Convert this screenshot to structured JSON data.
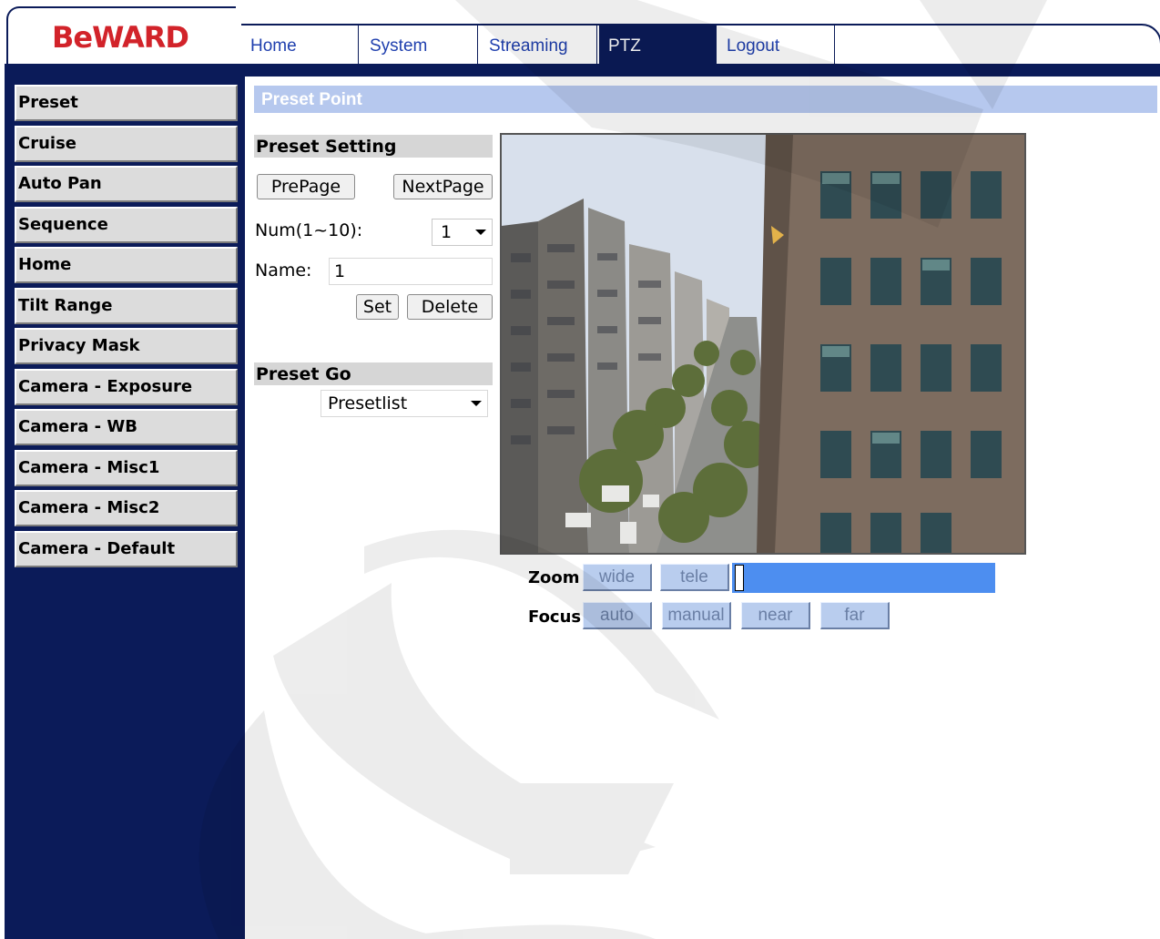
{
  "logo": {
    "text": "BeWARD"
  },
  "tabs": [
    {
      "label": "Home"
    },
    {
      "label": "System"
    },
    {
      "label": "Streaming"
    },
    {
      "label": "PTZ"
    },
    {
      "label": "Logout"
    }
  ],
  "sidebar": {
    "items": [
      {
        "label": "Preset"
      },
      {
        "label": "Cruise"
      },
      {
        "label": "Auto Pan"
      },
      {
        "label": "Sequence"
      },
      {
        "label": "Home"
      },
      {
        "label": "Tilt Range"
      },
      {
        "label": "Privacy Mask"
      },
      {
        "label": "Camera - Exposure"
      },
      {
        "label": "Camera - WB"
      },
      {
        "label": "Camera - Misc1"
      },
      {
        "label": "Camera - Misc2"
      },
      {
        "label": "Camera - Default"
      }
    ]
  },
  "page": {
    "title": "Preset Point"
  },
  "preset_setting": {
    "header": "Preset Setting",
    "prev_label": "PrePage",
    "next_label": "NextPage",
    "num_label": "Num(1~10):",
    "num_value": "1",
    "name_label": "Name:",
    "name_value": "1",
    "set_label": "Set",
    "delete_label": "Delete"
  },
  "preset_go": {
    "header": "Preset Go",
    "select_value": "Presetlist"
  },
  "ptz": {
    "zoom_label": "Zoom",
    "wide_label": "wide",
    "tele_label": "tele",
    "focus_label": "Focus",
    "auto_label": "auto",
    "manual_label": "manual",
    "near_label": "near",
    "far_label": "far"
  },
  "colors": {
    "navy": "#0b1b59",
    "logo_red": "#d2232a",
    "title_bar": "#b6c8ee",
    "ptz_button": "#b9cdee",
    "slider": "#4d8ef0"
  }
}
